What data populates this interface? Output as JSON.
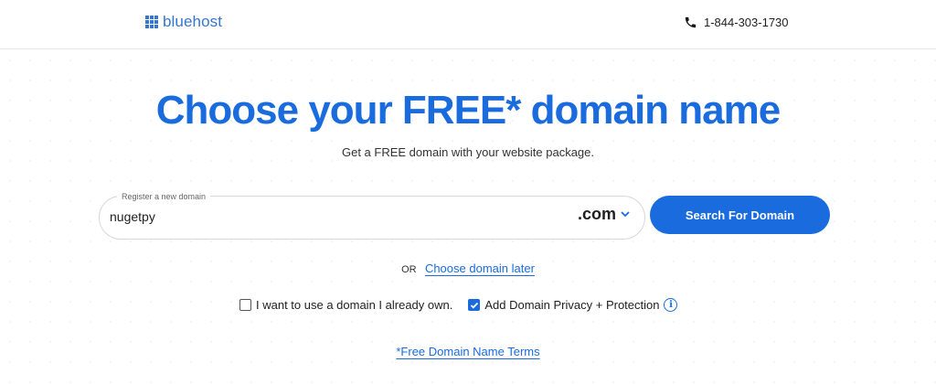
{
  "header": {
    "logo_text": "bluehost",
    "logo_icon": "grid-icon",
    "phone_icon": "phone-icon",
    "phone_number": "1-844-303-1730"
  },
  "hero": {
    "title": "Choose your FREE* domain name",
    "subtitle": "Get a FREE domain with your website package."
  },
  "search": {
    "label": "Register a new domain",
    "value": "nugetpy",
    "tld": ".com",
    "button_label": "Search For Domain"
  },
  "alt": {
    "or_text": "OR",
    "later_link": "Choose domain later"
  },
  "options": {
    "own_domain_label": "I want to use a domain I already own.",
    "own_domain_checked": false,
    "privacy_label": "Add Domain Privacy + Protection",
    "privacy_checked": true
  },
  "footer": {
    "terms_link": "*Free Domain Name Terms"
  },
  "colors": {
    "brand_blue": "#196bde",
    "logo_blue": "#3575d3"
  }
}
